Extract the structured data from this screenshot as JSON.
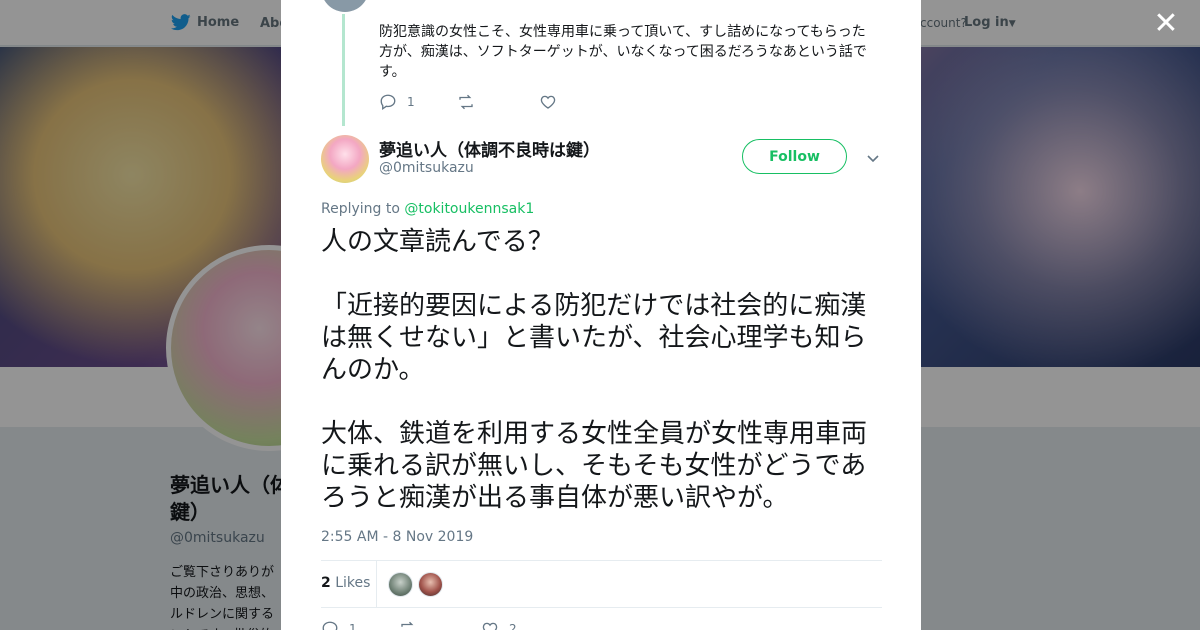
{
  "nav": {
    "home_label": "Home",
    "about_label": "Abo",
    "account_prompt": "ccount?",
    "login_label": "Log in"
  },
  "profile": {
    "name": "夢追い人（体調不良時は鍵）",
    "name_visible": "夢追い人（体\n鍵）",
    "handle": "@0mitsukazu",
    "bio_visible": "ご覧下さりありが\n中の政治、思想、\nルドレンに関する\nントです。批俗的"
  },
  "previous_tweet": {
    "text": "防犯意識の女性こそ、女性専用車に乗って頂いて、すし詰めになってもらった方が、痴漢は、ソフトターゲットが、いなくなって困るだろうなあという話です。",
    "reply_count": "1",
    "retweet_count": "",
    "like_count": ""
  },
  "tweet": {
    "author_name": "夢追い人（体調不良時は鍵）",
    "author_handle": "@0mitsukazu",
    "follow_label": "Follow",
    "replying_prefix": "Replying to",
    "replying_mention": "@tokitoukennsak1",
    "text": "人の文章読んでる？\n\n「近接的要因による防犯だけでは社会的に痴漢は無くせない」と書いたが、社会心理学も知らんのか。\n\n大体、鉄道を利用する女性全員が女性専用車両に乗れる訳が無いし、そもそも女性がどうであろうと痴漢が出る事自体が悪い訳やが。",
    "timestamp": "2:55 AM - 8 Nov 2019",
    "likes_count": "2",
    "likes_label": "Likes",
    "reply_count": "1",
    "like_count": "2"
  },
  "colors": {
    "accent": "#17bf63",
    "text": "#14171a",
    "muted": "#657786",
    "thread_line": "#b4e6cf"
  },
  "icons": {
    "close": "close-icon",
    "home": "twitter-bird-icon",
    "reply": "reply-icon",
    "retweet": "retweet-icon",
    "like": "heart-icon",
    "caret": "chevron-down-icon"
  }
}
